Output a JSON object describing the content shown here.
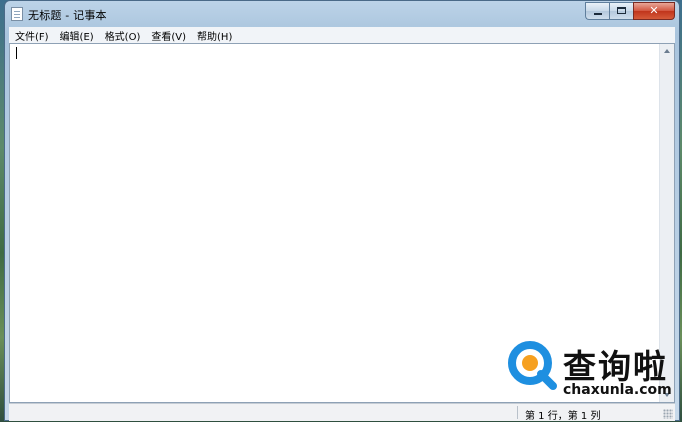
{
  "window": {
    "title": "无标题 - 记事本",
    "close_glyph": "✕"
  },
  "menu": [
    {
      "label": "文件(F)"
    },
    {
      "label": "编辑(E)"
    },
    {
      "label": "格式(O)"
    },
    {
      "label": "查看(V)"
    },
    {
      "label": "帮助(H)"
    }
  ],
  "editor": {
    "content": ""
  },
  "status": {
    "position": "第 1 行，第 1 列"
  },
  "watermark": {
    "chinese": "查询啦",
    "domain": "chaxunla.com"
  },
  "colors": {
    "logo_blue": "#1e8fe0",
    "logo_orange": "#f6a020"
  },
  "icons": {
    "app": "notepad-icon",
    "minimize": "minimize-icon",
    "maximize": "maximize-icon",
    "close": "close-icon"
  }
}
